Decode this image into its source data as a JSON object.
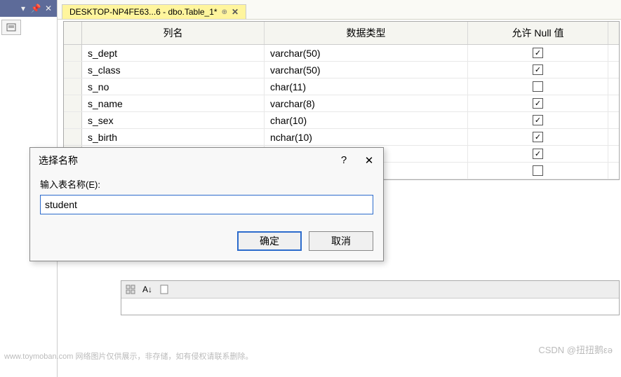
{
  "tab": {
    "title": "DESKTOP-NP4FE63...6 - dbo.Table_1*"
  },
  "columns": {
    "header": {
      "name": "列名",
      "type": "数据类型",
      "nullable": "允许 Null 值"
    },
    "rows": [
      {
        "name": "s_dept",
        "type": "varchar(50)",
        "nullable": true
      },
      {
        "name": "s_class",
        "type": "varchar(50)",
        "nullable": true
      },
      {
        "name": "s_no",
        "type": "char(11)",
        "nullable": false
      },
      {
        "name": "s_name",
        "type": "varchar(8)",
        "nullable": true
      },
      {
        "name": "s_sex",
        "type": "char(10)",
        "nullable": true
      },
      {
        "name": "s_birth",
        "type": "nchar(10)",
        "nullable": true
      },
      {
        "name": "",
        "type": "",
        "nullable": true
      },
      {
        "name": "",
        "type": "",
        "nullable": false
      }
    ]
  },
  "dialog": {
    "title": "选择名称",
    "label": "输入表名称(E):",
    "value": "student",
    "ok": "确定",
    "cancel": "取消"
  },
  "watermark": {
    "left": "www.toymoban.com 网络图片仅供展示，非存储，如有侵权请联系删除。",
    "right": "CSDN @扭扭鹅εə"
  }
}
